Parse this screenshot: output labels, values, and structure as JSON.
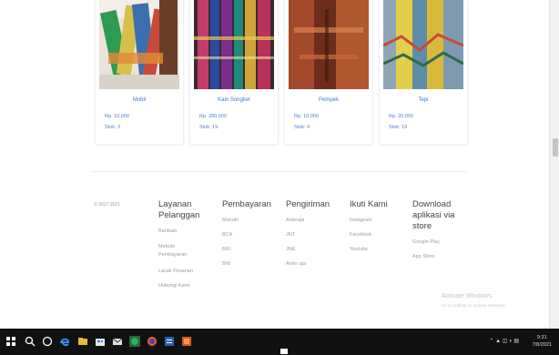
{
  "products": [
    {
      "name": "Mobil",
      "price": "Rp. 10.000",
      "stock": "Stok: 3"
    },
    {
      "name": "Kain Songket",
      "price": "Rp. 280.000",
      "stock": "Stok: 19"
    },
    {
      "name": "Pempek",
      "price": "Rp. 10.000",
      "stock": "Stok: 4"
    },
    {
      "name": "Tepi",
      "price": "Rp. 20.000",
      "stock": "Stok: 19"
    }
  ],
  "footer": {
    "copyright": "© 2017-2021",
    "columns": [
      {
        "heading": "Layanan Pelanggan",
        "links": [
          "Bantuan",
          "Metode Pembayaran",
          "Lacak Pesanan",
          "Hubungi Kami"
        ]
      },
      {
        "heading": "Pembayaran",
        "links": [
          "Mandiri",
          "BCA",
          "BRI",
          "BNI"
        ]
      },
      {
        "heading": "Pengiriman",
        "links": [
          "Anteraja",
          "JNT",
          "JNE",
          "Anter aja"
        ]
      },
      {
        "heading": "Ikuti Kami",
        "links": [
          "Instagram",
          "Facebook",
          "Youtube"
        ]
      },
      {
        "heading": "Download aplikasi via store",
        "links": [
          "Google Play",
          "App Store"
        ]
      }
    ]
  },
  "watermark": {
    "title": "Activate Windows",
    "subtitle": "Go to Settings to activate Windows."
  },
  "taskbar": {
    "time": "9:31",
    "date": "7/8/2021"
  }
}
